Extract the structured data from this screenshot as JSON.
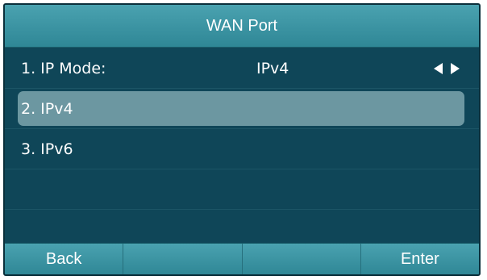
{
  "header": {
    "title": "WAN Port"
  },
  "items": [
    {
      "label": "1. IP Mode:",
      "value": "IPv4",
      "selected": false
    },
    {
      "label": "2. IPv4",
      "selected": true
    },
    {
      "label": "3. IPv6",
      "selected": false
    }
  ],
  "softkeys": [
    "Back",
    "",
    "",
    "Enter"
  ],
  "icons": {
    "prev": "triangle-left-icon",
    "next": "triangle-right-icon"
  },
  "colors": {
    "background": "#0f4658",
    "header": "#3b95a4",
    "highlight": "#6c97a1",
    "text": "#ffffff"
  }
}
